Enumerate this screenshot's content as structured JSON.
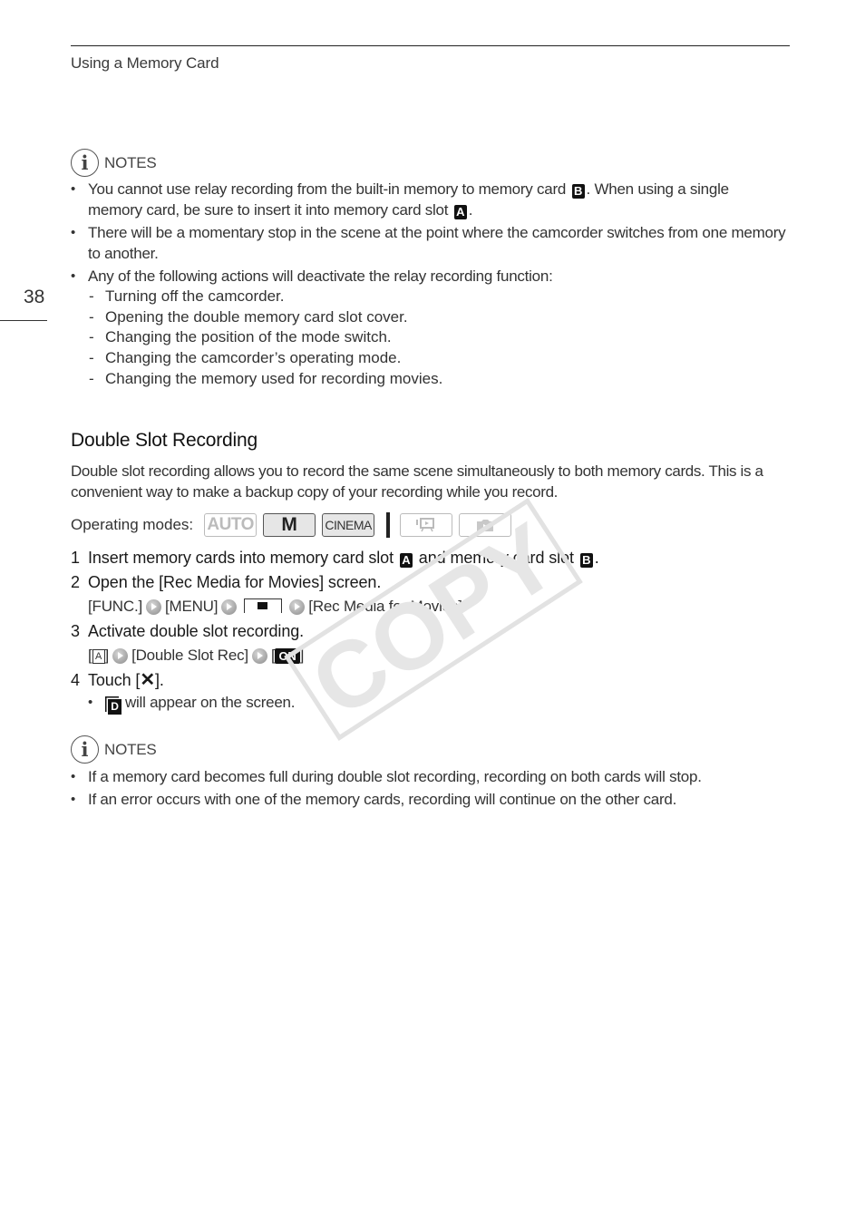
{
  "header": {
    "running_head": "Using a Memory Card",
    "page_number": "38"
  },
  "notes1": {
    "label": "NOTES",
    "icon": "info-icon",
    "items": [
      {
        "before": "You cannot use relay recording from the built-in memory to memory card ",
        "slot": "B",
        "after": ". When using a single memory card, be sure to insert it into memory card slot ",
        "slot2": "A",
        "end": "."
      },
      {
        "text": "There will be a momentary stop in the scene at the point where the camcorder switches from one memory to another."
      },
      {
        "text": "Any of the following actions will deactivate the relay recording function:",
        "subitems": [
          "Turning off the camcorder.",
          "Opening the double memory card slot cover.",
          "Changing the position of the mode switch.",
          "Changing the camcorder’s operating mode.",
          "Changing the memory used for recording movies."
        ]
      }
    ]
  },
  "section": {
    "title": "Double Slot Recording",
    "intro": "Double slot recording allows you to record the same scene simultaneously to both memory cards. This is a convenient way to make a backup copy of your recording while you record.",
    "operating_modes_label": "Operating modes:",
    "modes": [
      {
        "label": "AUTO",
        "active": false
      },
      {
        "label": "M",
        "active": true
      },
      {
        "label": "CINEMA",
        "active": true
      },
      {
        "label": "playback-movies-icon",
        "active": false
      },
      {
        "label": "playback-photos-icon",
        "active": false
      }
    ]
  },
  "steps": [
    {
      "num": "1",
      "before": "Insert memory cards into memory card slot ",
      "slot_a": "A",
      "mid": " and memory card slot ",
      "slot_b": "B",
      "end": "."
    },
    {
      "num": "2",
      "text": "Open the [Rec Media for Movies] screen.",
      "path": [
        "[FUNC.]",
        "[MENU]",
        "recording-setup-tab-icon",
        "[Rec Media for Movies]"
      ]
    },
    {
      "num": "3",
      "text": "Activate double slot recording.",
      "path": [
        "[",
        "A",
        "]",
        "[Double Slot Rec]",
        "[",
        "ON",
        "]"
      ]
    },
    {
      "num": "4",
      "before": "Touch [",
      "icon": "X",
      "after": "].",
      "bullet": {
        "icon": "D",
        "text": "will appear on the screen."
      }
    }
  ],
  "notes2": {
    "label": "NOTES",
    "items": [
      "If a memory card becomes full during double slot recording, recording on both cards will stop.",
      "If an error occurs with one of the memory cards, recording will continue on the other card."
    ]
  },
  "watermark": "COPY"
}
